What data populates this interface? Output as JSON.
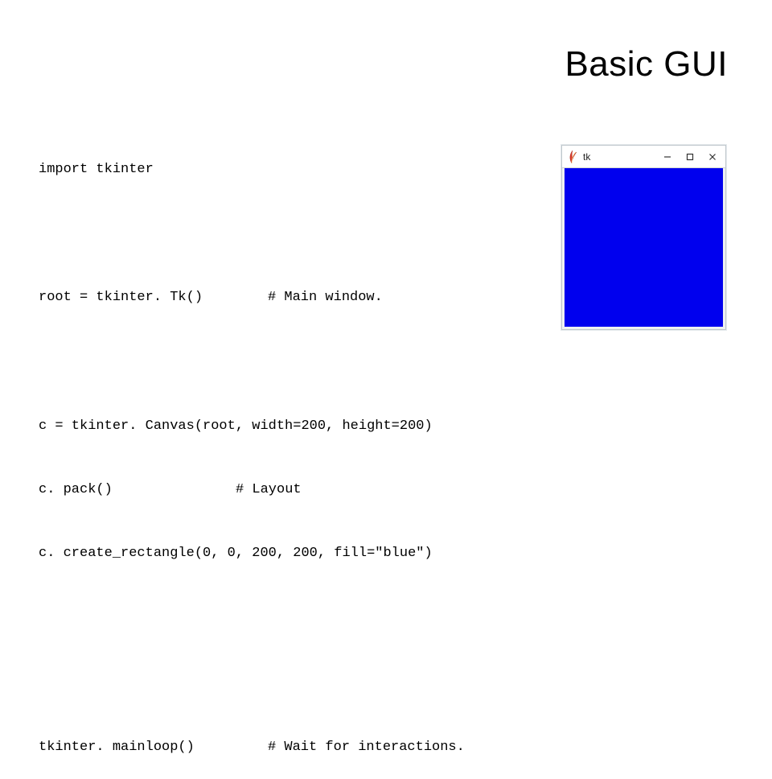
{
  "title": "Basic GUI",
  "code": {
    "line1": "import tkinter",
    "line2_left": "root = tkinter. Tk()",
    "line2_comment": "# Main window.",
    "line3": "c = tkinter. Canvas(root, width=200, height=200)",
    "line4_left": "c. pack()",
    "line4_comment": "# Layout",
    "line5": "c. create_rectangle(0, 0, 200, 200, fill=\"blue\")",
    "line6_left": "tkinter. mainloop()",
    "line6_comment": "# Wait for interactions."
  },
  "tk_window": {
    "title": "tk",
    "canvas_color": "#0000ee"
  }
}
